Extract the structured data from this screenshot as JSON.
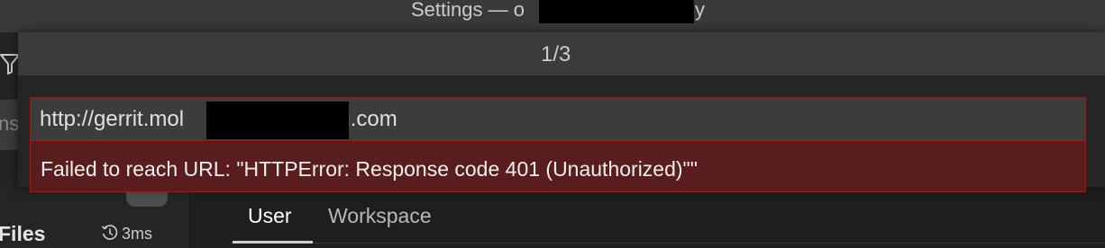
{
  "window": {
    "title_prefix": "Settings — o",
    "title_suffix": "y"
  },
  "sidebar": {
    "search_fragment": "ns",
    "files_label": "Files",
    "timing": "3ms"
  },
  "quick_input": {
    "step": "1/3",
    "input_value_prefix": "http://gerrit.mol",
    "input_value_suffix": "og.com",
    "error_message": "Failed to reach URL: \"HTTPError: Response code 401 (Unauthorized)\"\""
  },
  "settings_tabs": [
    {
      "label": "User",
      "active": true
    },
    {
      "label": "Workspace",
      "active": false
    }
  ],
  "colors": {
    "error_border": "#be1100",
    "error_background": "#5a1d1d",
    "input_background": "#3c3c3c"
  },
  "icons": [
    "filter-icon",
    "history-icon"
  ]
}
